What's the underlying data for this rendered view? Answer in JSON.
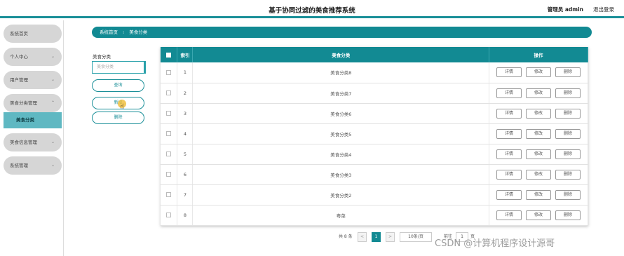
{
  "header": {
    "title": "基于协同过滤的美食推荐系统",
    "admin": "管理员 admin",
    "logout": "退出登录"
  },
  "sidebar": {
    "items": [
      {
        "label": "系统首页",
        "chevron": ""
      },
      {
        "label": "个人中心",
        "chevron": "⌄"
      },
      {
        "label": "用户管理",
        "chevron": "⌄"
      },
      {
        "label": "美食分类管理",
        "chevron": "⌃"
      },
      {
        "label": "美食信息管理",
        "chevron": "⌄"
      },
      {
        "label": "系统管理",
        "chevron": "⌄"
      }
    ],
    "active_sub": "美食分类"
  },
  "breadcrumb": {
    "home": "系统首页",
    "separator": "⁝",
    "current": "美食分类"
  },
  "filter": {
    "label": "美食分类",
    "placeholder": "美食分类",
    "query_btn": "查询",
    "add_btn": "新增",
    "delete_btn": "删除"
  },
  "table": {
    "headers": {
      "index": "索引",
      "category": "美食分类",
      "actions": "操作"
    },
    "action_labels": {
      "detail": "详情",
      "edit": "修改",
      "delete": "删除"
    },
    "rows": [
      {
        "index": "1",
        "category": "美食分类8"
      },
      {
        "index": "2",
        "category": "美食分类7"
      },
      {
        "index": "3",
        "category": "美食分类6"
      },
      {
        "index": "4",
        "category": "美食分类5"
      },
      {
        "index": "5",
        "category": "美食分类4"
      },
      {
        "index": "6",
        "category": "美食分类3"
      },
      {
        "index": "7",
        "category": "美食分类2"
      },
      {
        "index": "8",
        "category": "粤菜"
      }
    ]
  },
  "pagination": {
    "total": "共 8 条",
    "prev": "<",
    "page": "1",
    "next": ">",
    "page_size": "10条/页",
    "goto_label": "前往",
    "goto_value": "1",
    "page_suffix": "页"
  },
  "watermark": "CSDN @计算机程序设计源哥",
  "colors": {
    "accent": "#128a93",
    "active_sub": "#5fb8c2",
    "nav_bg": "#d6d6d6"
  }
}
